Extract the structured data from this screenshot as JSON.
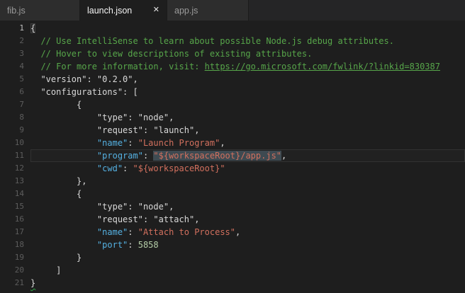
{
  "tab_bar": {
    "tabs": [
      {
        "label": "fib.js",
        "active": false,
        "close_icon": null
      },
      {
        "label": "launch.json",
        "active": true,
        "close_icon": "✕"
      },
      {
        "label": "app.js",
        "active": false,
        "close_icon": null
      }
    ]
  },
  "editor": {
    "lines": [
      {
        "num": "1",
        "gutter_style": "bright",
        "segments": [
          {
            "text": "{",
            "style": "bracket-match"
          }
        ]
      },
      {
        "num": "2",
        "segments": [
          {
            "text": "  // Use IntelliSense to learn about possible Node.js debug attributes.",
            "style": "comment"
          }
        ]
      },
      {
        "num": "3",
        "segments": [
          {
            "text": "  // Hover to view descriptions of existing attributes.",
            "style": "comment"
          }
        ]
      },
      {
        "num": "4",
        "segments": [
          {
            "text": "  // For more information, visit: ",
            "style": "comment"
          },
          {
            "text": "https://go.microsoft.com/fwlink/?linkid=830387",
            "style": "comment-link"
          }
        ]
      },
      {
        "num": "5",
        "segments": [
          {
            "text": "  \"version\": \"0.2.0\",",
            "style": "plain"
          }
        ]
      },
      {
        "num": "6",
        "segments": [
          {
            "text": "  \"configurations\": [",
            "style": "plain"
          }
        ]
      },
      {
        "num": "7",
        "segments": [
          {
            "text": "         {",
            "style": "plain"
          }
        ]
      },
      {
        "num": "8",
        "segments": [
          {
            "text": "             \"type\": \"node\",",
            "style": "plain"
          }
        ]
      },
      {
        "num": "9",
        "segments": [
          {
            "text": "             \"request\": \"launch\",",
            "style": "plain"
          }
        ]
      },
      {
        "num": "10",
        "segments": [
          {
            "text": "             ",
            "style": "plain"
          },
          {
            "text": "\"name\"",
            "style": "key"
          },
          {
            "text": ": ",
            "style": "plain"
          },
          {
            "text": "\"Launch Program\"",
            "style": "string"
          },
          {
            "text": ",",
            "style": "plain"
          }
        ]
      },
      {
        "num": "11",
        "current": true,
        "segments": [
          {
            "text": "             ",
            "style": "plain"
          },
          {
            "text": "\"program\"",
            "style": "key"
          },
          {
            "text": ": ",
            "style": "plain"
          },
          {
            "text": "\"${workspaceRoot}/app.js\"",
            "style": "string selected"
          },
          {
            "text": ",",
            "style": "plain"
          }
        ]
      },
      {
        "num": "12",
        "segments": [
          {
            "text": "             ",
            "style": "plain"
          },
          {
            "text": "\"cwd\"",
            "style": "key"
          },
          {
            "text": ": ",
            "style": "plain"
          },
          {
            "text": "\"${workspaceRoot}\"",
            "style": "string"
          }
        ]
      },
      {
        "num": "13",
        "segments": [
          {
            "text": "         },",
            "style": "plain"
          }
        ]
      },
      {
        "num": "14",
        "segments": [
          {
            "text": "         {",
            "style": "plain"
          }
        ]
      },
      {
        "num": "15",
        "segments": [
          {
            "text": "             \"type\": \"node\",",
            "style": "plain"
          }
        ]
      },
      {
        "num": "16",
        "segments": [
          {
            "text": "             \"request\": \"attach\",",
            "style": "plain"
          }
        ]
      },
      {
        "num": "17",
        "segments": [
          {
            "text": "             ",
            "style": "plain"
          },
          {
            "text": "\"name\"",
            "style": "key"
          },
          {
            "text": ": ",
            "style": "plain"
          },
          {
            "text": "\"Attach to Process\"",
            "style": "string"
          },
          {
            "text": ",",
            "style": "plain"
          }
        ]
      },
      {
        "num": "18",
        "segments": [
          {
            "text": "             ",
            "style": "plain"
          },
          {
            "text": "\"port\"",
            "style": "key"
          },
          {
            "text": ": ",
            "style": "plain"
          },
          {
            "text": "5858",
            "style": "number"
          }
        ]
      },
      {
        "num": "19",
        "segments": [
          {
            "text": "         }",
            "style": "plain"
          }
        ]
      },
      {
        "num": "20",
        "segments": [
          {
            "text": "     ]",
            "style": "plain"
          }
        ]
      },
      {
        "num": "21",
        "segments": [
          {
            "text": "}",
            "style": "squiggle"
          }
        ]
      }
    ]
  },
  "colors": {
    "editor_bg": "#1e1e1e",
    "tabbar_bg": "#252526",
    "tab_inactive_bg": "#2d2d2d",
    "tab_active_bg": "#1e1e1e",
    "tab_inactive_fg": "#9b9b9b",
    "tab_active_fg": "#f5f5f5",
    "gutter_fg": "#5d5d5d",
    "gutter_bright_fg": "#c0c0c0",
    "plain": "#d9d9d9",
    "comment": "#57a64a",
    "key": "#55b1e2",
    "string": "#d2705e",
    "number": "#b5cea8",
    "selection": "#3e4a51",
    "current_line_border": "#323232",
    "current_line_bg": "#212121",
    "match_border": "#3f3f3f",
    "squiggle": "#2ea043"
  }
}
